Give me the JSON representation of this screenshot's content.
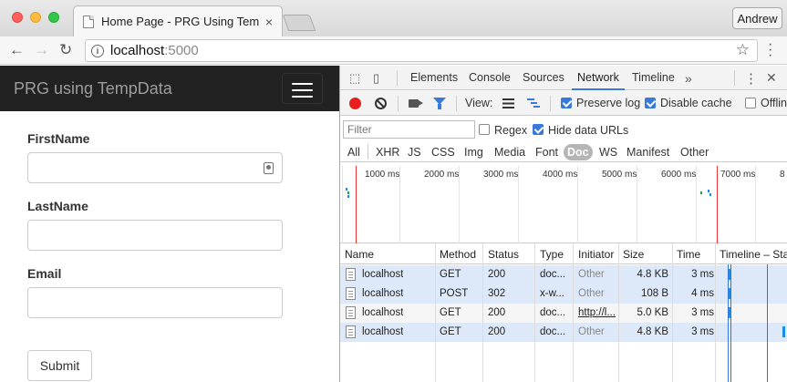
{
  "browser": {
    "tab_title": "Home Page - PRG Using TempData",
    "tab_close": "×",
    "profile_name": "Andrew",
    "url_host": "localhost",
    "url_port": ":5000"
  },
  "page": {
    "brand": "PRG using TempData",
    "labels": {
      "first_name": "FirstName",
      "last_name": "LastName",
      "email": "Email"
    },
    "submit_label": "Submit"
  },
  "devtools": {
    "tabs": [
      "Elements",
      "Console",
      "Sources",
      "Network",
      "Timeline"
    ],
    "active_tab": "Network",
    "more_tabs": "»",
    "toolbar": {
      "view_label": "View:",
      "preserve_log": "Preserve log",
      "disable_cache": "Disable cache",
      "offline": "Offlin"
    },
    "filter": {
      "placeholder": "Filter",
      "regex": "Regex",
      "hide_data_urls": "Hide data URLs"
    },
    "types": [
      "All",
      "XHR",
      "JS",
      "CSS",
      "Img",
      "Media",
      "Font",
      "Doc",
      "WS",
      "Manifest",
      "Other"
    ],
    "active_type": "Doc",
    "overview_ticks": [
      "1000 ms",
      "2000 ms",
      "3000 ms",
      "4000 ms",
      "5000 ms",
      "6000 ms",
      "7000 ms",
      "8"
    ],
    "columns": [
      "Name",
      "Method",
      "Status",
      "Type",
      "Initiator",
      "Size",
      "Time",
      "Timeline – Start"
    ],
    "rows": [
      {
        "name": "localhost",
        "method": "GET",
        "status": "200",
        "type": "doc...",
        "initiator": "Other",
        "size": "4.8 KB",
        "time": "3 ms",
        "wf_pos": 0.13
      },
      {
        "name": "localhost",
        "method": "POST",
        "status": "302",
        "type": "x-w...",
        "initiator": "Other",
        "size": "108 B",
        "time": "4 ms",
        "wf_pos": 0.13
      },
      {
        "name": "localhost",
        "method": "GET",
        "status": "200",
        "type": "doc...",
        "initiator": "http://l...",
        "size": "5.0 KB",
        "time": "3 ms",
        "wf_pos": 0.13
      },
      {
        "name": "localhost",
        "method": "GET",
        "status": "200",
        "type": "doc...",
        "initiator": "Other",
        "size": "4.8 KB",
        "time": "3 ms",
        "wf_pos": 0.96
      }
    ],
    "colors": {
      "accent": "#3879d9",
      "record": "#e8201d",
      "selected_row": "#dde9f9"
    }
  }
}
